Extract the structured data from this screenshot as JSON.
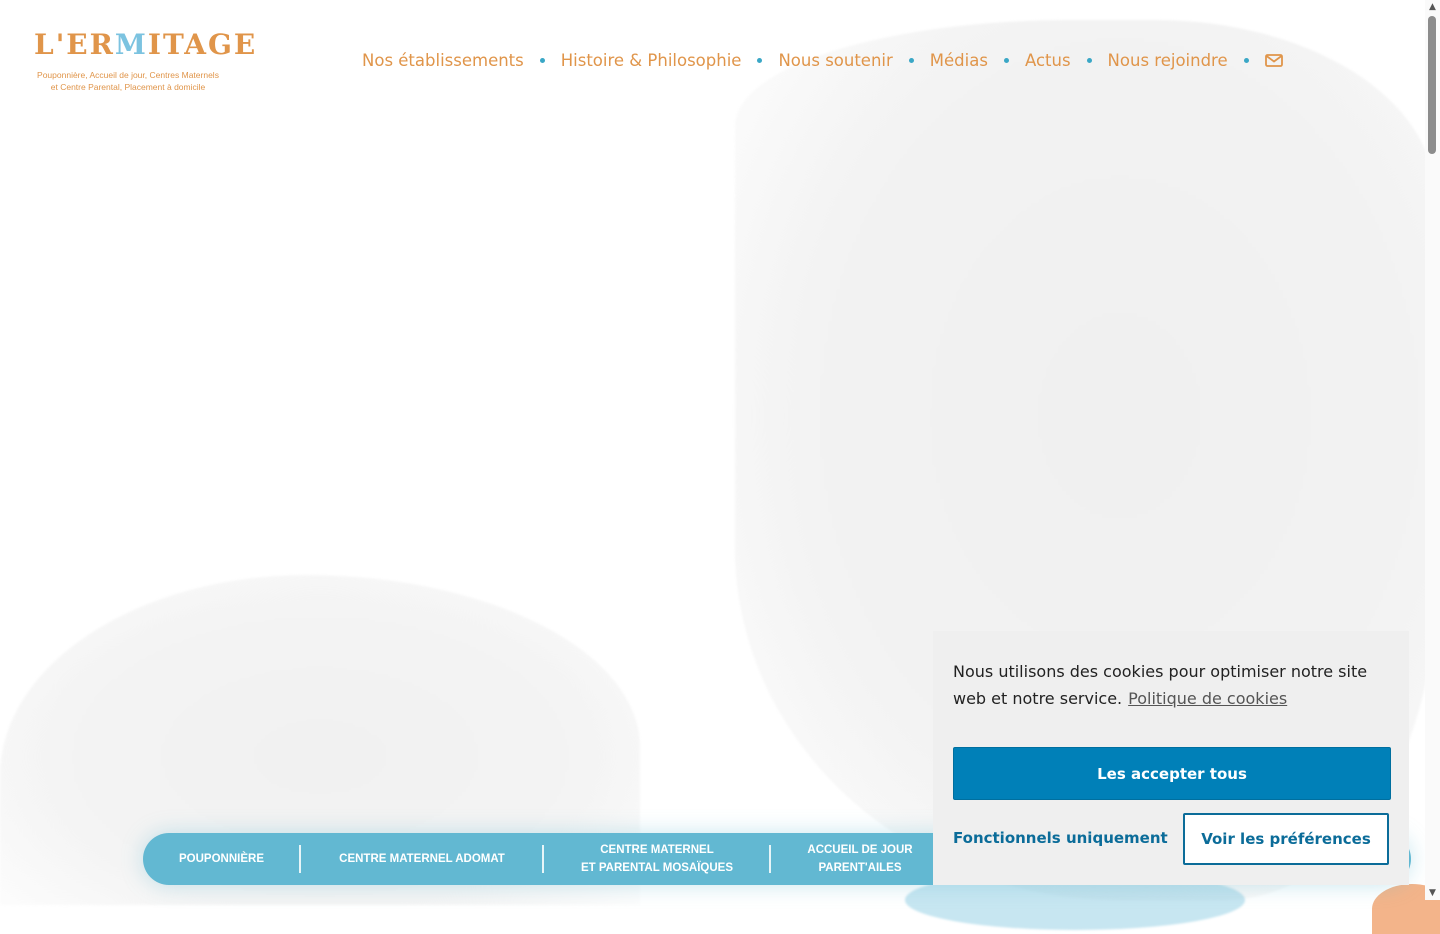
{
  "logo": {
    "word_prefix": "L'ER",
    "word_m": "M",
    "word_suffix": "ITAGE",
    "subtitle_line1": "Pouponnière, Accueil de jour, Centres Maternels",
    "subtitle_line2": "et Centre Parental, Placement à domicile"
  },
  "nav": {
    "items": [
      {
        "label": "Nos établissements"
      },
      {
        "label": "Histoire & Philosophie"
      },
      {
        "label": "Nous soutenir"
      },
      {
        "label": "Médias"
      },
      {
        "label": "Actus"
      },
      {
        "label": "Nous rejoindre"
      }
    ],
    "mail_icon": "envelope-icon"
  },
  "pill_nav": {
    "items": [
      {
        "line1": "POUPONNIÈRE",
        "line2": ""
      },
      {
        "line1": "CENTRE MATERNEL ADOMAT",
        "line2": ""
      },
      {
        "line1": "CENTRE MATERNEL",
        "line2": "ET PARENTAL MOSAÏQUES"
      },
      {
        "line1": "ACCUEIL DE JOUR",
        "line2": "PARENT'AILES"
      }
    ]
  },
  "cookie": {
    "text": "Nous utilisons des cookies pour optimiser notre site web et notre service.",
    "policy_link": "Politique de cookies",
    "accept_label": "Les accepter tous",
    "functional_label": "Fonctionnels uniquement",
    "prefs_label": "Voir les préférences"
  },
  "colors": {
    "brand_orange": "#e0954a",
    "brand_blue": "#62b8d2",
    "accept_blue": "#0080b8"
  }
}
